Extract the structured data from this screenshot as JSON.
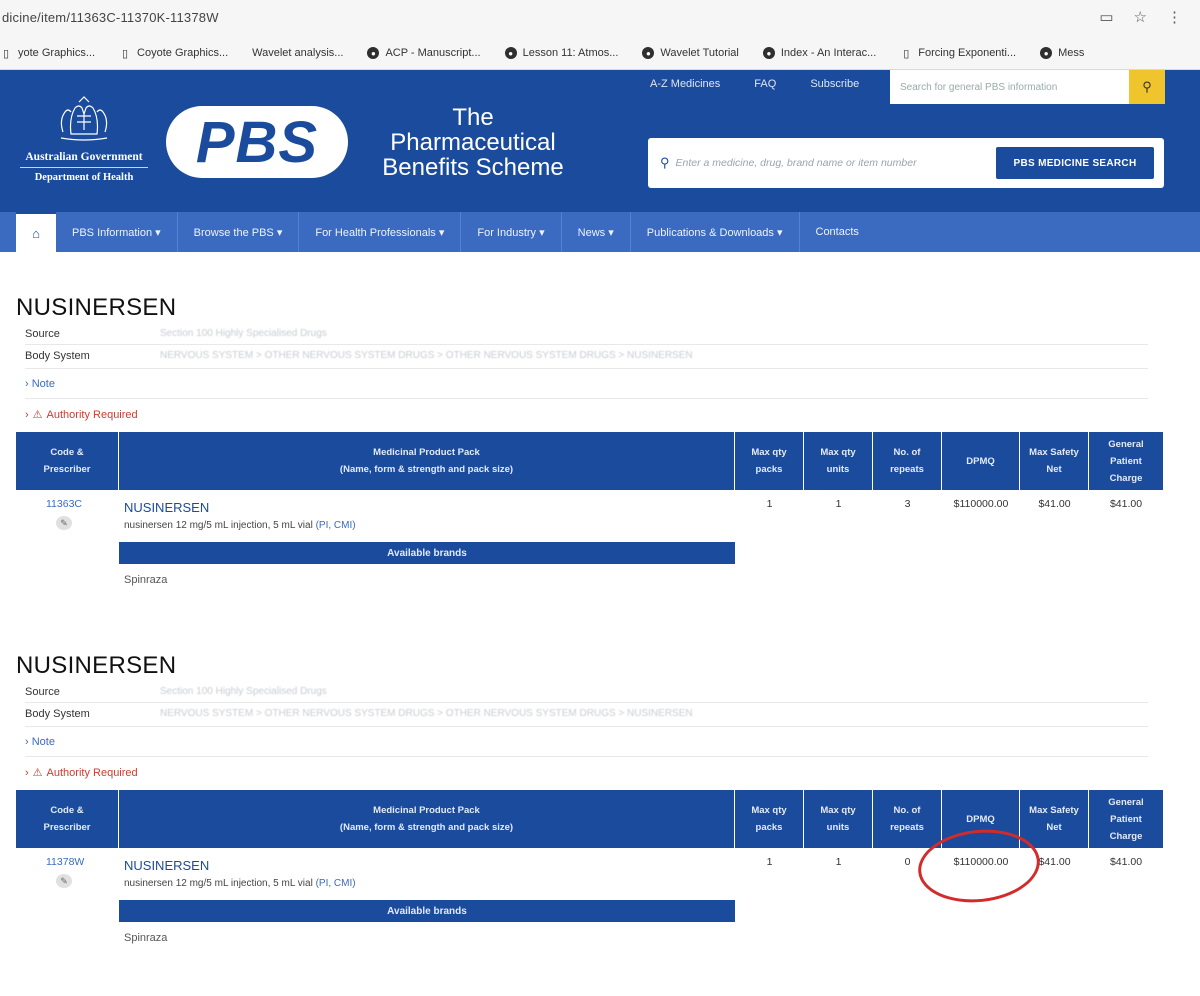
{
  "browser": {
    "url": "dicine/item/11363C-11370K-11378W",
    "bookmarks": [
      {
        "label": "yote Graphics...",
        "icon": "page"
      },
      {
        "label": "Coyote Graphics...",
        "icon": "page"
      },
      {
        "label": "Wavelet analysis...",
        "icon": "none"
      },
      {
        "label": "ACP - Manuscript...",
        "icon": "globe"
      },
      {
        "label": "Lesson 11: Atmos...",
        "icon": "globe"
      },
      {
        "label": "Wavelet Tutorial",
        "icon": "globe"
      },
      {
        "label": "Index - An Interac...",
        "icon": "globe"
      },
      {
        "label": "Forcing Exponenti...",
        "icon": "page"
      },
      {
        "label": "Mess",
        "icon": "globe"
      }
    ]
  },
  "header": {
    "top_links": [
      "A-Z Medicines",
      "FAQ",
      "Subscribe"
    ],
    "top_search_placeholder": "Search for general PBS information",
    "gov_line1": "Australian Government",
    "gov_line2": "Department of Health",
    "pbs_logo": "PBS",
    "scheme_title": "The\nPharmaceutical\nBenefits Scheme",
    "medicine_search_placeholder": "Enter a medicine, drug, brand name or item number",
    "medicine_search_button": "PBS MEDICINE SEARCH"
  },
  "nav": {
    "items": [
      "PBS Information ▾",
      "Browse the PBS ▾",
      "For Health Professionals ▾",
      "For Industry ▾",
      "News ▾",
      "Publications & Downloads ▾",
      "Contacts"
    ]
  },
  "labels": {
    "source": "Source",
    "body_system": "Body System",
    "note": "› Note",
    "authority": "Authority Required",
    "source_value": "Section 100 Highly Specialised Drugs",
    "body_system_value": "NERVOUS SYSTEM > OTHER NERVOUS SYSTEM DRUGS > OTHER NERVOUS SYSTEM DRUGS > NUSINERSEN",
    "available_brands": "Available brands"
  },
  "table_headers": {
    "code": "Code &\nPrescriber",
    "pack": "Medicinal Product Pack\n(Name, form & strength and pack size)",
    "max_packs": "Max qty\npacks",
    "max_units": "Max qty\nunits",
    "repeats": "No. of\nrepeats",
    "dpmq": "DPMQ",
    "safety_net": "Max Safety\nNet",
    "general_charge": "General\nPatient\nCharge"
  },
  "items": [
    {
      "title": "NUSINERSEN",
      "code": "11363C",
      "drug_name": "NUSINERSEN",
      "drug_desc": "nusinersen 12 mg/5 mL injection, 5 mL vial",
      "drug_links": "(PI, CMI)",
      "max_packs": "1",
      "max_units": "1",
      "repeats": "3",
      "dpmq": "$110000.00",
      "safety_net": "$41.00",
      "general_charge": "$41.00",
      "brand": "Spinraza"
    },
    {
      "title": "NUSINERSEN",
      "code": "11378W",
      "drug_name": "NUSINERSEN",
      "drug_desc": "nusinersen 12 mg/5 mL injection, 5 mL vial",
      "drug_links": "(PI, CMI)",
      "max_packs": "1",
      "max_units": "1",
      "repeats": "0",
      "dpmq": "$110000.00",
      "safety_net": "$41.00",
      "general_charge": "$41.00",
      "brand": "Spinraza"
    }
  ],
  "colors": {
    "brand_blue": "#1a4b9c",
    "nav_blue": "#3a6bc0",
    "search_yellow": "#f0c42c",
    "alert_red": "#d13a2f",
    "highlight_red": "#d42a2a"
  }
}
